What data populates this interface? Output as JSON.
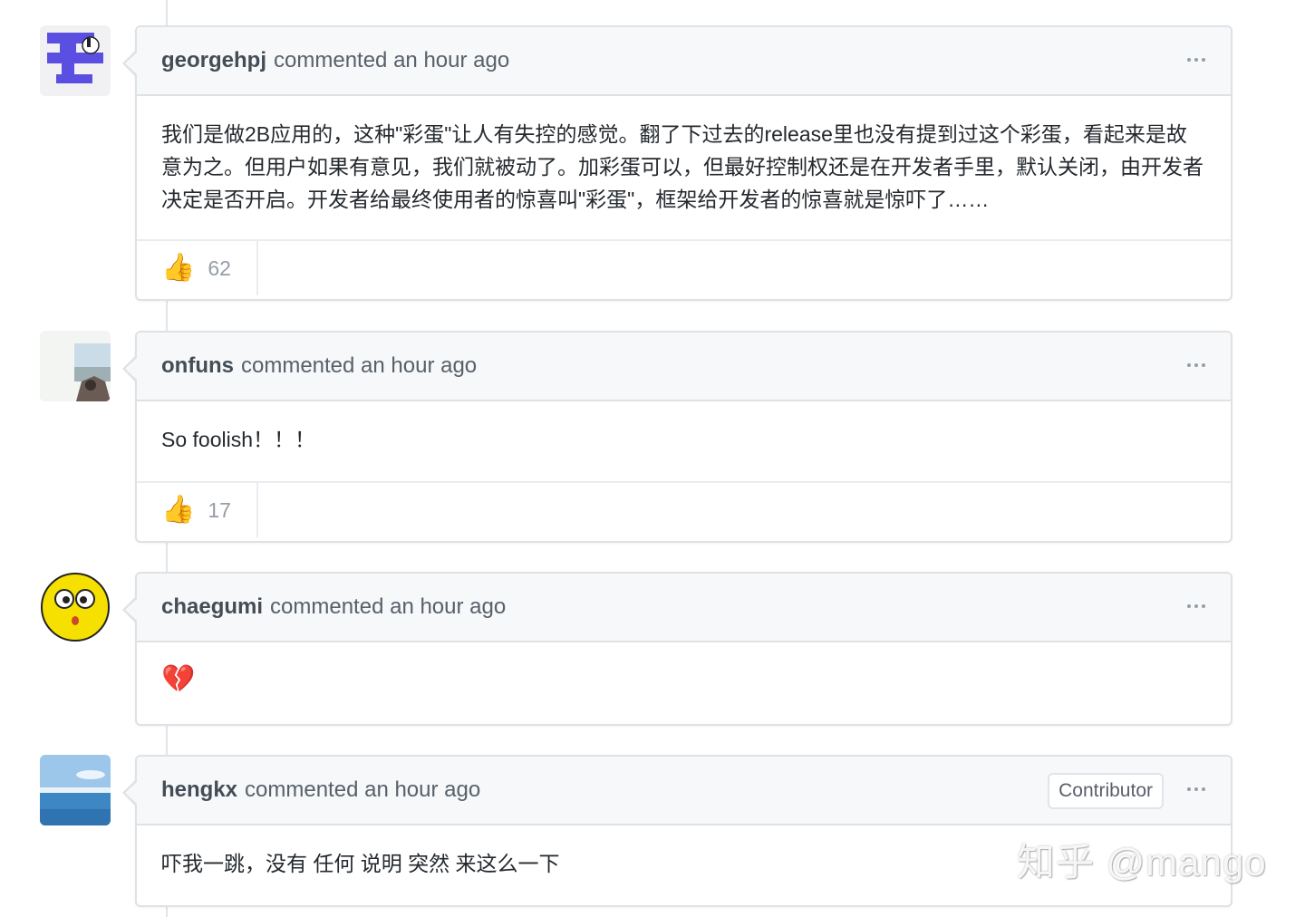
{
  "comments": [
    {
      "author": "georgehpj",
      "meta": "commented an hour ago",
      "body": "我们是做2B应用的，这种\"彩蛋\"让人有失控的感觉。翻了下过去的release里也没有提到过这个彩蛋，看起来是故意为之。但用户如果有意见，我们就被动了。加彩蛋可以，但最好控制权还是在开发者手里，默认关闭，由开发者决定是否开启。开发者给最终使用者的惊喜叫\"彩蛋\"，框架给开发者的惊喜就是惊吓了……",
      "reaction_count": "62"
    },
    {
      "author": "onfuns",
      "meta": "commented an hour ago",
      "body": "So foolish！！！",
      "reaction_count": "17"
    },
    {
      "author": "chaegumi",
      "meta": "commented an hour ago",
      "body": "💔"
    },
    {
      "author": "hengkx",
      "meta": "commented an hour ago",
      "badge": "Contributor",
      "body": "吓我一跳，没有 任何 说明 突然 来这么一下"
    }
  ],
  "reaction_emoji": "👍",
  "watermark": "知乎 @mango",
  "icons": {
    "more": "more-horizontal-icon",
    "reaction": "thumbs-up-icon",
    "heart": "broken-heart-icon"
  },
  "colors": {
    "header_bg": "#f6f8fa",
    "border": "#dfe2e5",
    "author_text": "#444d56",
    "muted_text": "#586069",
    "avatar_purple": "#5a4fe0"
  }
}
